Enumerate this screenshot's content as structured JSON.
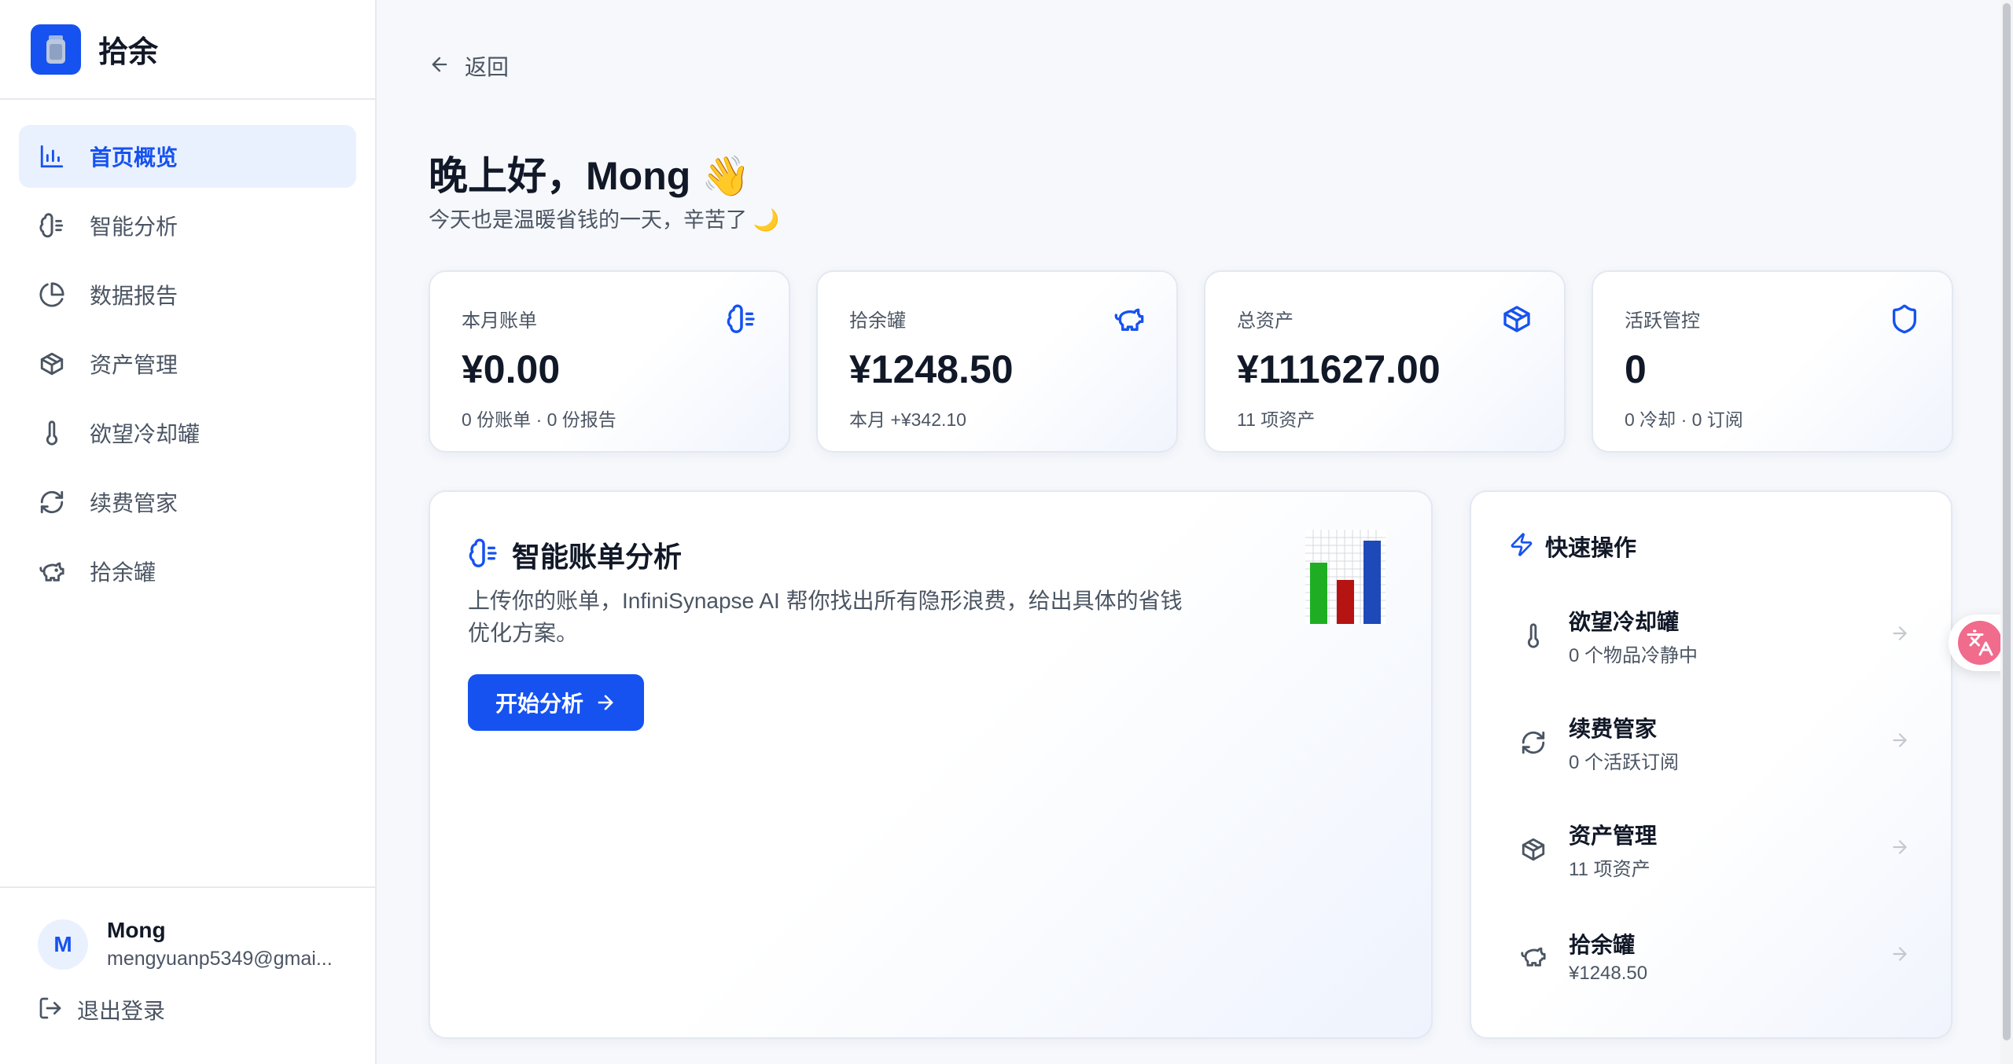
{
  "brand": {
    "name": "拾余"
  },
  "sidebar": {
    "items": [
      {
        "label": "首页概览",
        "icon": "bar-chart-icon",
        "active": true
      },
      {
        "label": "智能分析",
        "icon": "brain-icon"
      },
      {
        "label": "数据报告",
        "icon": "pie-chart-icon"
      },
      {
        "label": "资产管理",
        "icon": "box-icon"
      },
      {
        "label": "欲望冷却罐",
        "icon": "thermometer-icon"
      },
      {
        "label": "续费管家",
        "icon": "refresh-icon"
      },
      {
        "label": "拾余罐",
        "icon": "piggy-bank-icon"
      }
    ],
    "user": {
      "initial": "M",
      "name": "Mong",
      "email": "mengyuanp5349@gmai..."
    },
    "logout_label": "退出登录"
  },
  "main": {
    "back_label": "返回",
    "greeting": "晚上好，Mong 👋",
    "subtitle": "今天也是温暖省钱的一天，辛苦了 🌙",
    "stats": [
      {
        "label": "本月账单",
        "value": "¥0.00",
        "note": "0 份账单 · 0 份报告",
        "icon": "brain-icon"
      },
      {
        "label": "拾余罐",
        "value": "¥1248.50",
        "note": "本月 +¥342.10",
        "icon": "piggy-bank-icon"
      },
      {
        "label": "总资产",
        "value": "¥111627.00",
        "note": "11 项资产",
        "icon": "box-icon"
      },
      {
        "label": "活跃管控",
        "value": "0",
        "note": "0 冷却 · 0 订阅",
        "icon": "shield-icon"
      }
    ],
    "ai_card": {
      "title": "智能账单分析",
      "description": "上传你的账单，InfiniSynapse AI 帮你找出所有隐形浪费，给出具体的省钱优化方案。",
      "button_label": "开始分析",
      "illustration": "bar-chart-emoji"
    },
    "quick": {
      "title": "快速操作",
      "items": [
        {
          "title": "欲望冷却罐",
          "subtitle": "0 个物品冷静中",
          "icon": "thermometer-icon"
        },
        {
          "title": "续费管家",
          "subtitle": "0 个活跃订阅",
          "icon": "refresh-icon"
        },
        {
          "title": "资产管理",
          "subtitle": "11 项资产",
          "icon": "box-icon"
        },
        {
          "title": "拾余罐",
          "subtitle": "¥1248.50",
          "icon": "piggy-bank-icon"
        }
      ]
    }
  },
  "colors": {
    "accent": "#1652f0",
    "accent_soft": "#eaf1fe",
    "text": "#111827",
    "muted": "#4b5563",
    "translate_badge": "#f06b8c"
  }
}
